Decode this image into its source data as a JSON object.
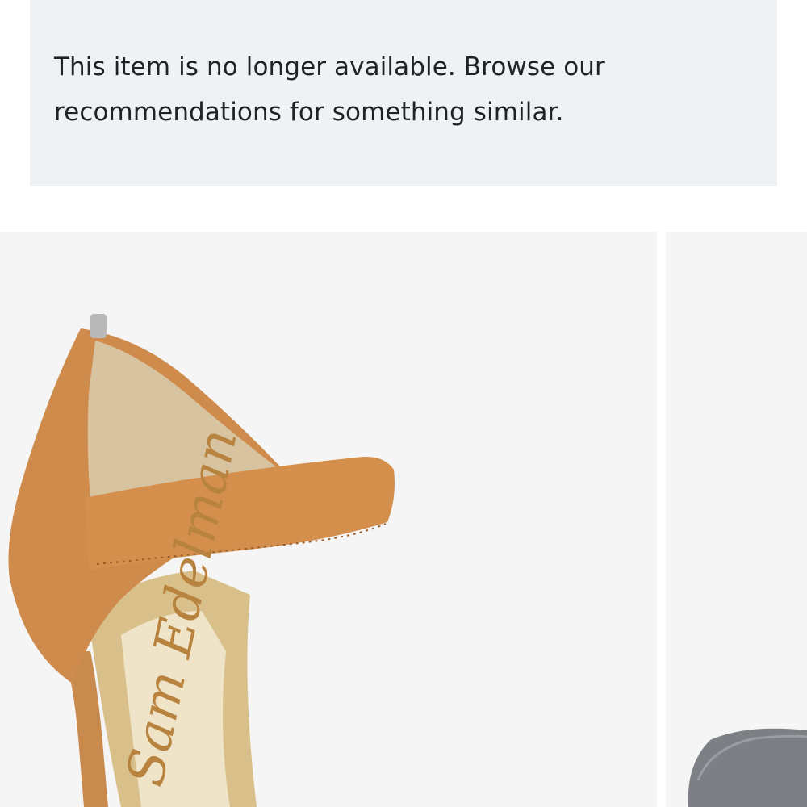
{
  "notice": {
    "message_line1": "This item is no longer available. Browse our",
    "message_line2": "recommendations for something similar."
  },
  "recommendations": {
    "items": [
      {
        "image": "tan-leather-ankle-strap-heel-sandal",
        "brand_script": "Sam Edelman"
      },
      {
        "image": "gray-suede-pointed-toe-shoe"
      }
    ]
  },
  "colors": {
    "notice_background": "#eff2f5",
    "card_background": "#f5f5f5",
    "text": "#1f2328"
  }
}
